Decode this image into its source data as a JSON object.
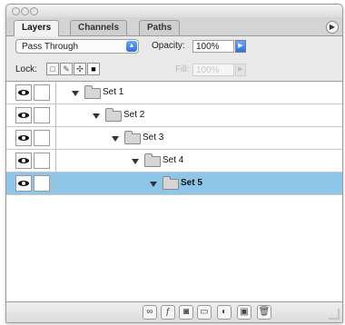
{
  "tabs": [
    {
      "label": "Layers",
      "active": true
    },
    {
      "label": "Channels",
      "active": false
    },
    {
      "label": "Paths",
      "active": false
    }
  ],
  "blend_mode": "Pass Through",
  "opacity": {
    "label": "Opacity:",
    "value": "100%"
  },
  "lock": {
    "label": "Lock:"
  },
  "fill": {
    "label": "Fill:",
    "value": "100%"
  },
  "layers": [
    {
      "name": "Set 1",
      "selected": false
    },
    {
      "name": "Set 2",
      "selected": false
    },
    {
      "name": "Set 3",
      "selected": false
    },
    {
      "name": "Set 4",
      "selected": false
    },
    {
      "name": "Set 5",
      "selected": true
    }
  ],
  "colors": {
    "selection": "#8ec6ea",
    "accent": "#2f6fe0"
  },
  "icons": {
    "titlebar": [
      "traffic-light-close-icon",
      "traffic-light-minimize-icon",
      "traffic-light-zoom-icon"
    ],
    "bottom": [
      "link-layers-icon",
      "layer-style-icon",
      "layer-mask-icon",
      "new-group-icon",
      "adjustment-layer-icon",
      "new-layer-icon",
      "trash-icon"
    ]
  }
}
